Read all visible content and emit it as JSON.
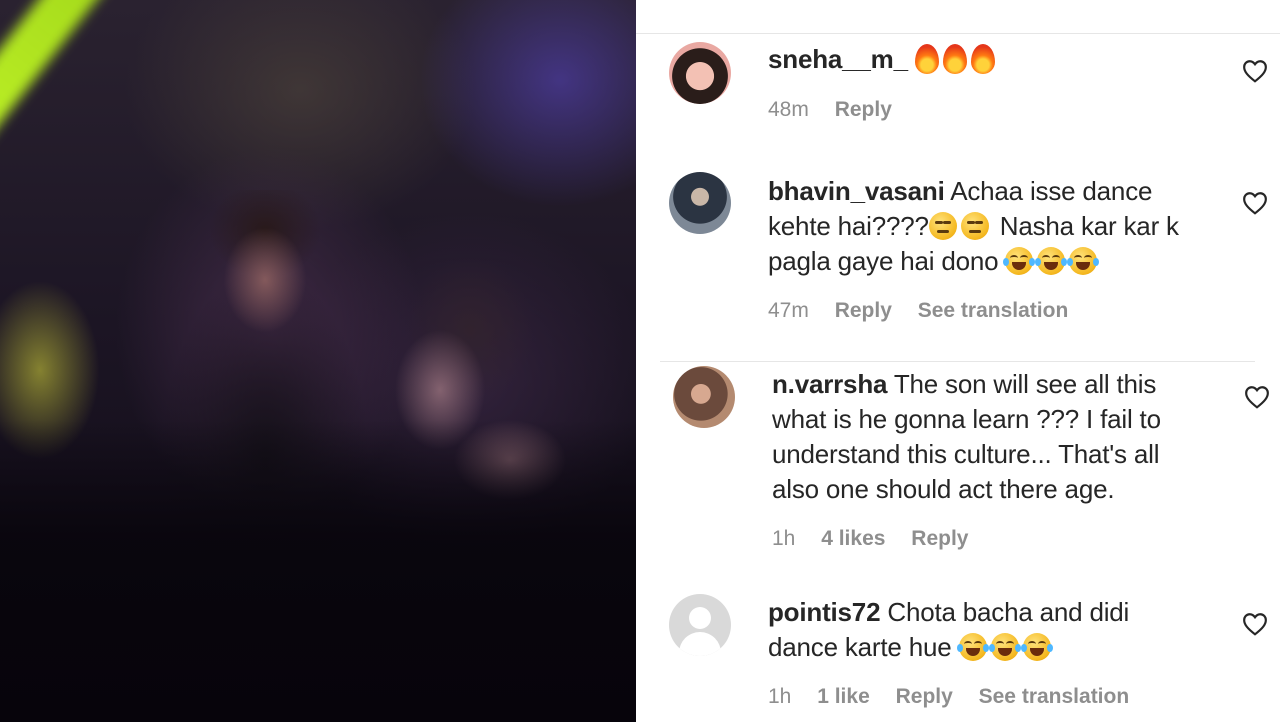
{
  "comments": [
    {
      "username": "sneha__m_",
      "text": "",
      "emojis": [
        "fire",
        "fire",
        "fire"
      ],
      "time": "48m",
      "likes": "",
      "reply_label": "Reply",
      "translation_label": ""
    },
    {
      "username": "bhavin_vasani",
      "text_part1": "Achaa isse dance",
      "text_part2": "kehte hai????",
      "text_part3": " Nasha kar kar k",
      "text_part4": "pagla gaye hai dono ",
      "emojis_a": [
        "neutral",
        "neutral"
      ],
      "emojis_b": [
        "joy",
        "joy",
        "joy"
      ],
      "time": "47m",
      "reply_label": "Reply",
      "translation_label": "See translation"
    },
    {
      "username": "n.varrsha",
      "text_line1": "The son will see all this",
      "text_line2": "what is he gonna learn ??? I fail to",
      "text_line3": "understand this culture... That's all",
      "text_line4": "also one should act there age.",
      "time": "1h",
      "likes": "4 likes",
      "reply_label": "Reply"
    },
    {
      "username": "pointis72",
      "text_line1": "Chota bacha and didi",
      "text_line2": "dance karte hue ",
      "emojis": [
        "joy",
        "joy",
        "joy"
      ],
      "time": "1h",
      "likes": "1 like",
      "reply_label": "Reply",
      "translation_label": "See translation"
    }
  ],
  "colors": {
    "text": "#262626",
    "meta": "#8e8e8e",
    "divider": "#e6e6e6",
    "video_beam": "#b8f020"
  },
  "icons": {
    "like": "heart-outline-icon",
    "default_avatar": "default-avatar-icon"
  }
}
